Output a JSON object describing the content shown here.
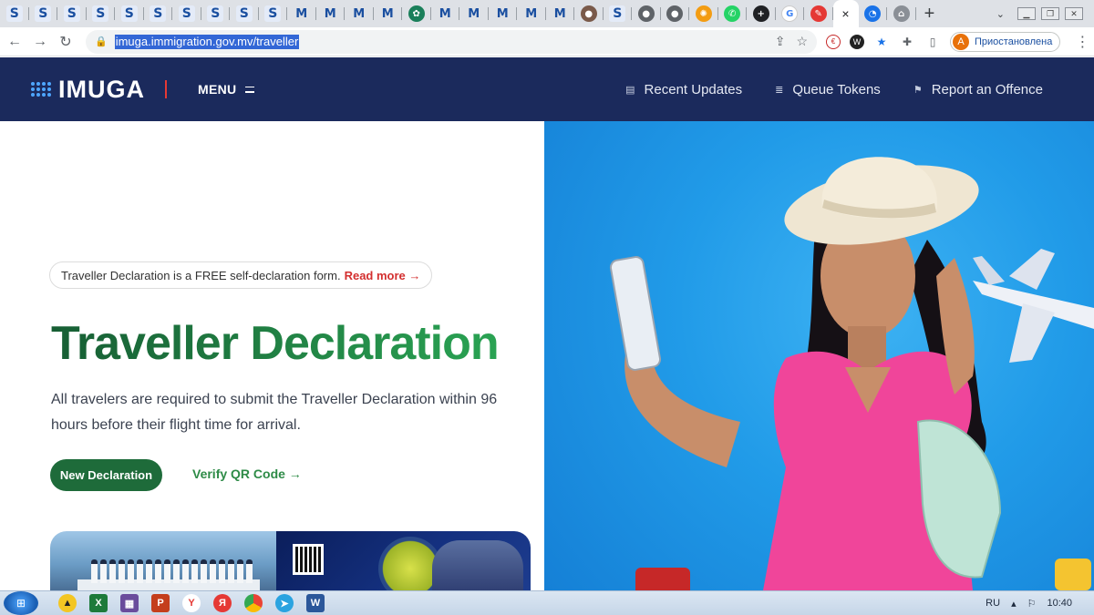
{
  "browser": {
    "tabs": [
      {
        "glyph": "S",
        "kind": "s"
      },
      {
        "glyph": "S",
        "kind": "s"
      },
      {
        "glyph": "S",
        "kind": "s"
      },
      {
        "glyph": "S",
        "kind": "s"
      },
      {
        "glyph": "S",
        "kind": "s"
      },
      {
        "glyph": "S",
        "kind": "s"
      },
      {
        "glyph": "S",
        "kind": "s"
      },
      {
        "glyph": "S",
        "kind": "s"
      },
      {
        "glyph": "S",
        "kind": "s"
      },
      {
        "glyph": "S",
        "kind": "s"
      },
      {
        "glyph": "M",
        "kind": "m"
      },
      {
        "glyph": "M",
        "kind": "m"
      },
      {
        "glyph": "M",
        "kind": "m"
      },
      {
        "glyph": "M",
        "kind": "m"
      },
      {
        "glyph": "✿",
        "kind": "emblem"
      },
      {
        "glyph": "M",
        "kind": "m"
      },
      {
        "glyph": "M",
        "kind": "m"
      },
      {
        "glyph": "M",
        "kind": "m"
      },
      {
        "glyph": "M",
        "kind": "m"
      },
      {
        "glyph": "M",
        "kind": "m"
      },
      {
        "glyph": "●",
        "kind": "photo"
      },
      {
        "glyph": "S",
        "kind": "s"
      },
      {
        "glyph": "●",
        "kind": "gray"
      },
      {
        "glyph": "●",
        "kind": "gray"
      },
      {
        "glyph": "✺",
        "kind": "sun"
      },
      {
        "glyph": "✆",
        "kind": "whatsapp"
      },
      {
        "glyph": "+",
        "kind": "plus"
      },
      {
        "glyph": "G",
        "kind": "google"
      },
      {
        "glyph": "✎",
        "kind": "red"
      }
    ],
    "active_tab_close": "×",
    "extra_tabs": [
      {
        "glyph": "◔",
        "kind": "blue"
      },
      {
        "glyph": "⌂",
        "kind": "home"
      }
    ],
    "new_tab": "+",
    "url": "imuga.immigration.gov.mv/traveller",
    "profile_initial": "A",
    "profile_label": "Приостановлена"
  },
  "header": {
    "logo": "IMUGA",
    "menu": "MENU",
    "nav": [
      {
        "label": "Recent Updates",
        "icon": "▤"
      },
      {
        "label": "Queue Tokens",
        "icon": "≣"
      },
      {
        "label": "Report an Offence",
        "icon": "⚑"
      }
    ]
  },
  "hero": {
    "notice_text": "Traveller Declaration is a FREE self-declaration form.",
    "notice_link": "Read more →",
    "title": "Traveller Declaration",
    "description": "All travelers are required to submit the Traveller Declaration within 96 hours before their flight time for arrival.",
    "primary_button": "New Declaration",
    "secondary_link": "Verify QR Code →"
  },
  "taskbar": {
    "language": "RU",
    "time": "10:40"
  },
  "colors": {
    "header_bg": "#1b2a5c",
    "title_green": "#1b7a43",
    "button_green": "#1e6b3a",
    "link_red": "#d32f2f",
    "hero_blue": "#219be8",
    "dress_pink": "#f0459a"
  }
}
